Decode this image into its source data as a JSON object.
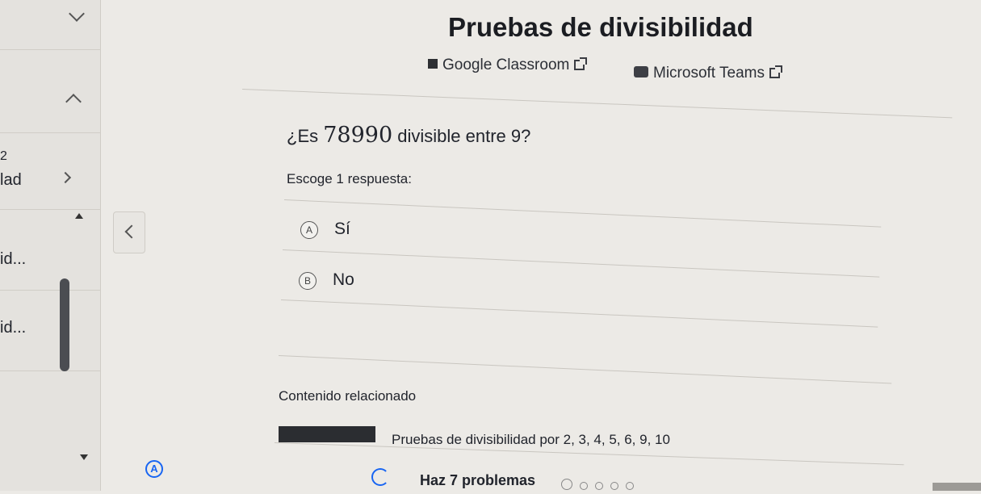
{
  "sidebar": {
    "rows": [
      {
        "label": "",
        "icon": "chevron-down-icon"
      },
      {
        "label": "",
        "icon": "chevron-up-icon"
      },
      {
        "label": "2"
      },
      {
        "label": "lad",
        "icon": "chevron-right-icon"
      },
      {
        "label": "id..."
      },
      {
        "label": "id..."
      }
    ]
  },
  "header": {
    "title": "Pruebas de divisibilidad",
    "share": [
      {
        "label": "Google Classroom",
        "icon": "google-classroom-icon"
      },
      {
        "label": "Microsoft Teams",
        "icon": "microsoft-teams-icon"
      }
    ]
  },
  "question": {
    "prefix": "¿Es ",
    "number": "78990",
    "suffix": " divisible entre 9?",
    "prompt": "Escoge 1 respuesta:",
    "choices": [
      {
        "letter": "A",
        "label": "Sí"
      },
      {
        "letter": "B",
        "label": "No"
      }
    ]
  },
  "related": {
    "title": "Contenido relacionado",
    "video_label": "Pruebas de divisibilidad por 2, 3, 4, 5, 6, 9, 10"
  },
  "footer": {
    "badge": "A",
    "task_label": "Haz 7 problemas"
  }
}
